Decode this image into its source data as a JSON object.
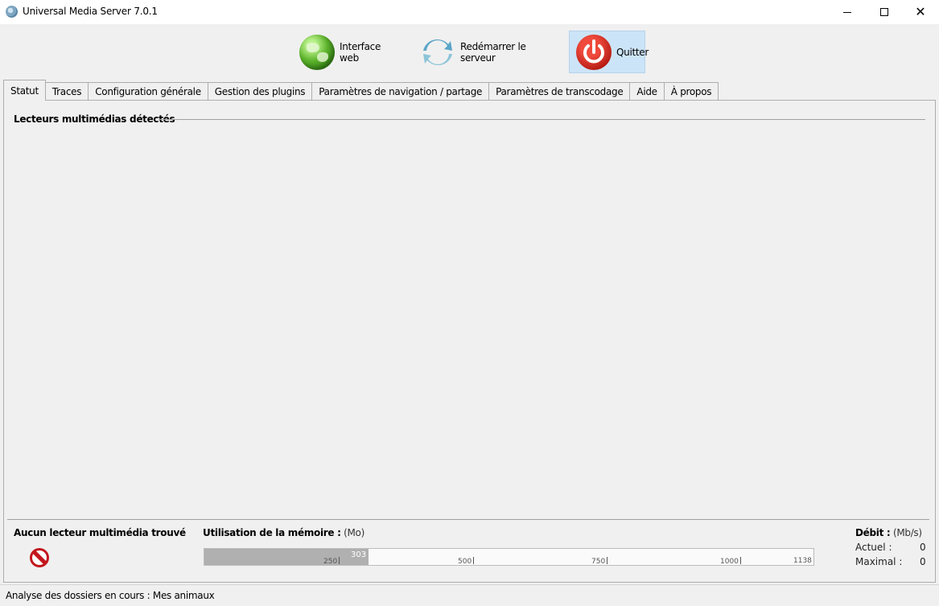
{
  "window": {
    "title": "Universal Media Server 7.0.1"
  },
  "toolbar": {
    "web_label": "Interface web",
    "restart_label": "Redémarrer le serveur",
    "quit_label": "Quitter"
  },
  "tabs": [
    {
      "label": "Statut",
      "active": true
    },
    {
      "label": "Traces"
    },
    {
      "label": "Configuration générale"
    },
    {
      "label": "Gestion des plugins"
    },
    {
      "label": "Paramètres de navigation / partage"
    },
    {
      "label": "Paramètres de transcodage"
    },
    {
      "label": "Aide"
    },
    {
      "label": "À propos"
    }
  ],
  "status": {
    "section_title": "Lecteurs multimédias détectés",
    "no_renderer": "Aucun lecteur multimédia trouvé",
    "memory": {
      "label": "Utilisation de la mémoire :",
      "unit": "(Mo)",
      "used": 303,
      "max": 1138,
      "used_label": "303",
      "ticks": [
        "250",
        "500",
        "750",
        "1000"
      ],
      "max_label": "1138"
    },
    "bitrate": {
      "label": "Débit :",
      "unit": "(Mb/s)",
      "current_label": "Actuel :",
      "current_value": "0",
      "max_label": "Maximal :",
      "max_value": "0"
    }
  },
  "statusbar": {
    "text": "Analyse des dossiers en cours : Mes animaux"
  }
}
